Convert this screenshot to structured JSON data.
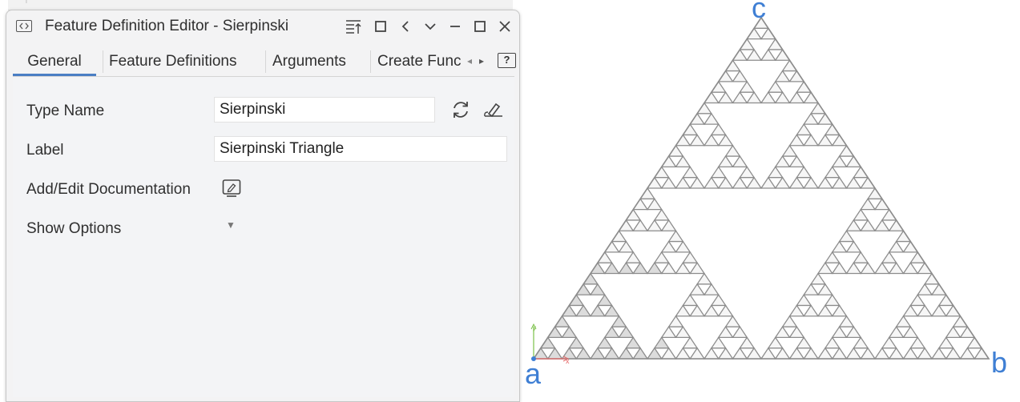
{
  "window": {
    "title": "Feature Definition Editor - Sierpinski",
    "icons": {
      "title": "code-window-icon",
      "collapse": "collapse-list-icon",
      "float": "square-icon",
      "back": "chevron-left-icon",
      "menu": "chevron-down-icon",
      "minimize": "minimize-icon",
      "maximize": "maximize-icon",
      "close": "close-icon"
    }
  },
  "tabs": [
    {
      "label": "General",
      "active": true
    },
    {
      "label": "Feature Definitions",
      "active": false
    },
    {
      "label": "Arguments",
      "active": false
    },
    {
      "label": "Create Func",
      "active": false
    }
  ],
  "tab_controls": {
    "scroll_left": "◂",
    "scroll_right": "▸",
    "help": "?"
  },
  "general": {
    "type_name": {
      "label": "Type Name",
      "value": "Sierpinski"
    },
    "label": {
      "label": "Label",
      "value": "Sierpinski Triangle"
    },
    "documentation": {
      "label": "Add/Edit Documentation"
    },
    "show_options": {
      "label": "Show Options",
      "arrow": "▼"
    }
  },
  "viewport": {
    "vertex_labels": {
      "a": "a",
      "b": "b",
      "c": "c"
    },
    "axis_labels": {
      "x": "x",
      "y": "y"
    },
    "fractal_depth": 5,
    "colors": {
      "label": "#3f7fd4",
      "line": "#8c8c8c",
      "fill": "#f6f6f6",
      "shade": "#dcdcdc",
      "x_axis": "#e46a6a",
      "y_axis": "#7cc04a",
      "origin": "#3f7fd4"
    }
  }
}
